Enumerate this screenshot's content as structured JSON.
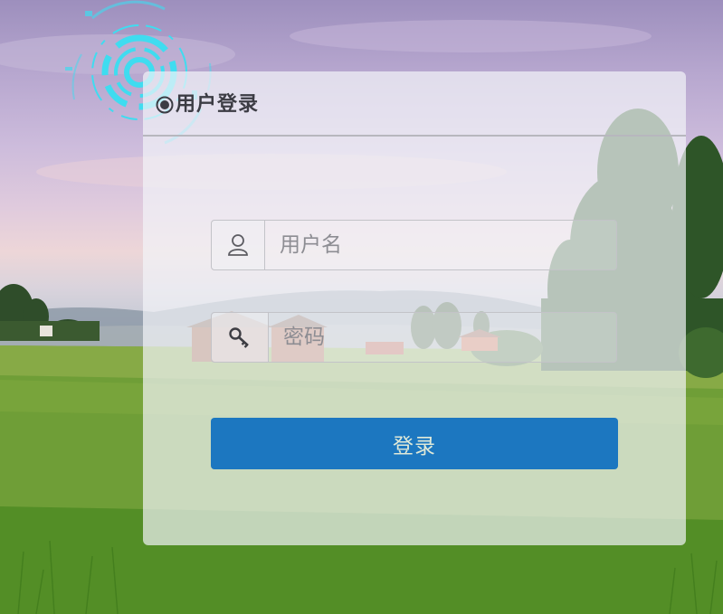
{
  "login_panel": {
    "title": "用户登录",
    "username": {
      "placeholder": "用户名",
      "value": "",
      "icon": "user-icon"
    },
    "password": {
      "placeholder": "密码",
      "value": "",
      "icon": "key-icon"
    },
    "submit_label": "登录"
  },
  "colors": {
    "button": "#1c77c0",
    "button_text": "#dfe9d8",
    "title_text": "#3c3c44",
    "accent_ring": "#3fdcf0"
  },
  "icons": {
    "title_bullet": "radio-bullet-icon",
    "decoration": "tech-ring-icon"
  }
}
